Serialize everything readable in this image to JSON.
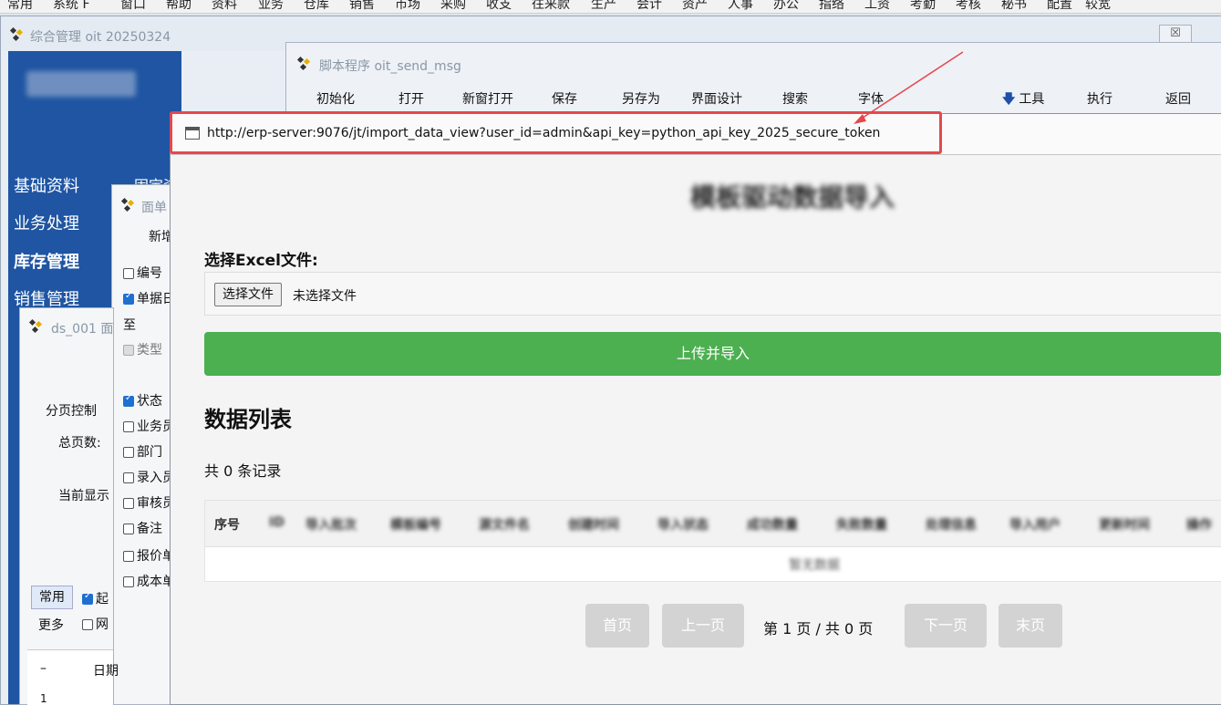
{
  "menubar": {
    "items": [
      "常用",
      "系统 F",
      "窗口",
      "帮助",
      "资料",
      "业务",
      "仓库",
      "销售",
      "市场",
      "采购",
      "收支",
      "往来款",
      "生产",
      "会计",
      "资产",
      "人事",
      "办公",
      "指络",
      "工资",
      "考勤",
      "考核",
      "秘书",
      "配置",
      "较宽"
    ]
  },
  "main_window": {
    "title": "综合管理 oit 20250324",
    "close_label": "☒",
    "side_items": [
      "基础资料",
      "业务处理",
      "库存管理",
      "销售管理"
    ],
    "side_col2_peek": "固定资"
  },
  "doc_window": {
    "title": "面单",
    "add_label": "新增",
    "checkboxes": [
      {
        "label": "编号",
        "checked": false,
        "disabled": false
      },
      {
        "label": "单据日",
        "checked": true,
        "disabled": false
      },
      {
        "label": "类型",
        "checked": false,
        "disabled": true
      },
      {
        "label": "状态",
        "checked": true,
        "disabled": false
      },
      {
        "label": "业务员",
        "checked": false,
        "disabled": false
      },
      {
        "label": "部门",
        "checked": false,
        "disabled": false
      },
      {
        "label": "录入员",
        "checked": false,
        "disabled": false
      },
      {
        "label": "审核员",
        "checked": false,
        "disabled": false
      },
      {
        "label": "备注",
        "checked": false,
        "disabled": false
      },
      {
        "label": "报价单",
        "checked": false,
        "disabled": false
      },
      {
        "label": "成本单",
        "checked": false,
        "disabled": false
      }
    ],
    "to_label": "至"
  },
  "ds_window": {
    "title": "ds_001 面",
    "paging_label": "分页控制",
    "total_pages_label": "总页数:",
    "current_label": "当前显示",
    "tab_common": "常用",
    "tab_more": "更多",
    "cb_start": "起",
    "cb_net": "网",
    "grid_dash": "–",
    "grid_date": "日期",
    "grid_row1": "1"
  },
  "script_window": {
    "title": "脚本程序 oit_send_msg",
    "toolbar": [
      "初始化",
      "打开",
      "新窗打开",
      "保存",
      "另存为",
      "界面设计",
      "搜索",
      "字体",
      "工具",
      "执行",
      "返回"
    ]
  },
  "popup": {
    "url": "http://erp-server:9076/jt/import_data_view?user_id=admin&api_key=python_api_key_2025_secure_token",
    "page_title": "模板驱动数据导入",
    "file_label": "选择Excel文件:",
    "file_button": "选择文件",
    "file_status": "未选择文件",
    "upload_button": "上传并导入",
    "list_title": "数据列表",
    "record_count": "共 0 条记录",
    "table_headers": [
      "序号",
      "ID",
      "导入批次",
      "模板编号",
      "源文件名",
      "创建时间",
      "导入状态",
      "成功数量",
      "失败数量",
      "处理信息",
      "导入用户",
      "更新时间",
      "操作"
    ],
    "no_data": "暂无数据",
    "pagination": {
      "first": "首页",
      "prev": "上一页",
      "info": "第 1 页 / 共 0 页",
      "next": "下一页",
      "last": "末页"
    }
  },
  "colors": {
    "side_panel": "#1f55a2",
    "upload_green": "#4caf50",
    "highlight_red": "#e5484d",
    "disabled_gray": "#d3d3d3"
  }
}
